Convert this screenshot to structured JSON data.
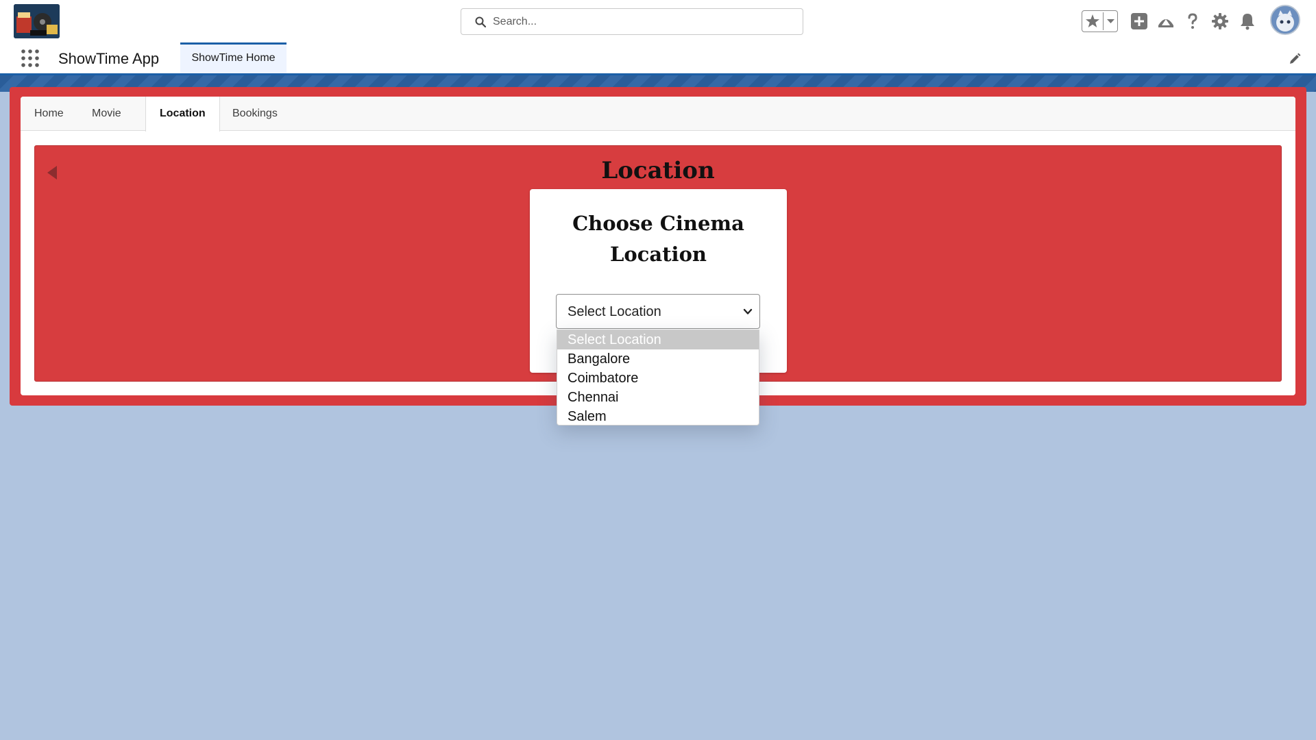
{
  "header": {
    "search_placeholder": "Search..."
  },
  "app_nav": {
    "app_name": "ShowTime App",
    "active_tab_label": "ShowTime Home"
  },
  "tabs": [
    {
      "label": "Home"
    },
    {
      "label": "Movie"
    },
    {
      "label": "Location",
      "active": true
    },
    {
      "label": "Bookings"
    }
  ],
  "location_panel": {
    "title": "Location",
    "card_title_line1": "Choose Cinema",
    "card_title_line2": "Location",
    "select_value": "Select Location",
    "options": [
      "Select Location",
      "Bangalore",
      "Coimbatore",
      "Chennai",
      "Salem"
    ]
  },
  "colors": {
    "panel_red": "#d83a3e",
    "nav_blue": "#1b5fa7",
    "page_background": "#b0c4df"
  },
  "icons": {
    "search": "search-icon",
    "favorites": "star-icon",
    "favorites_menu": "chevron-down-icon",
    "add": "plus-icon",
    "trailhead": "trailhead-icon",
    "help": "help-icon",
    "settings": "gear-icon",
    "notifications": "bell-icon",
    "app_launcher": "waffle-icon",
    "edit_nav": "pencil-icon",
    "back": "back-arrow-icon"
  }
}
